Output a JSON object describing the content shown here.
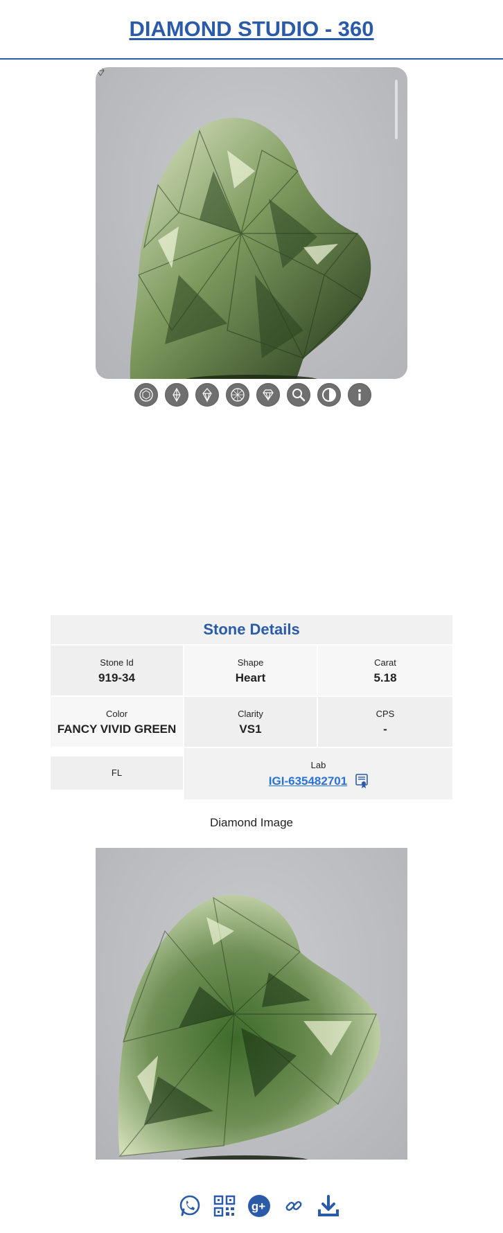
{
  "header": {
    "title": "DIAMOND STUDIO - 360"
  },
  "viewer": {
    "toolbar": [
      {
        "name": "top-view-icon"
      },
      {
        "name": "side-view-icon"
      },
      {
        "name": "pavilion-view-icon"
      },
      {
        "name": "bottom-view-icon"
      },
      {
        "name": "diamond-profile-icon"
      },
      {
        "name": "zoom-icon"
      },
      {
        "name": "contrast-icon"
      },
      {
        "name": "info-icon"
      }
    ]
  },
  "details": {
    "title": "Stone Details",
    "stone_id": {
      "label": "Stone Id",
      "value": "919-34"
    },
    "shape": {
      "label": "Shape",
      "value": "Heart"
    },
    "carat": {
      "label": "Carat",
      "value": "5.18"
    },
    "color": {
      "label": "Color",
      "value": "FANCY VIVID GREEN"
    },
    "clarity": {
      "label": "Clarity",
      "value": "VS1"
    },
    "cps": {
      "label": "CPS",
      "value": "-"
    },
    "fl": "FL",
    "lab": {
      "label": "Lab",
      "value": "IGI-635482701"
    }
  },
  "image_section": {
    "caption": "Diamond Image"
  },
  "share": [
    {
      "name": "whatsapp-icon"
    },
    {
      "name": "qr-code-icon"
    },
    {
      "name": "google-plus-icon"
    },
    {
      "name": "link-icon"
    },
    {
      "name": "download-icon"
    }
  ],
  "colors": {
    "brand": "#2b5ba8",
    "link": "#2a73d6",
    "gem_dark": "#2f4a22",
    "gem_light": "#b8c99a"
  }
}
